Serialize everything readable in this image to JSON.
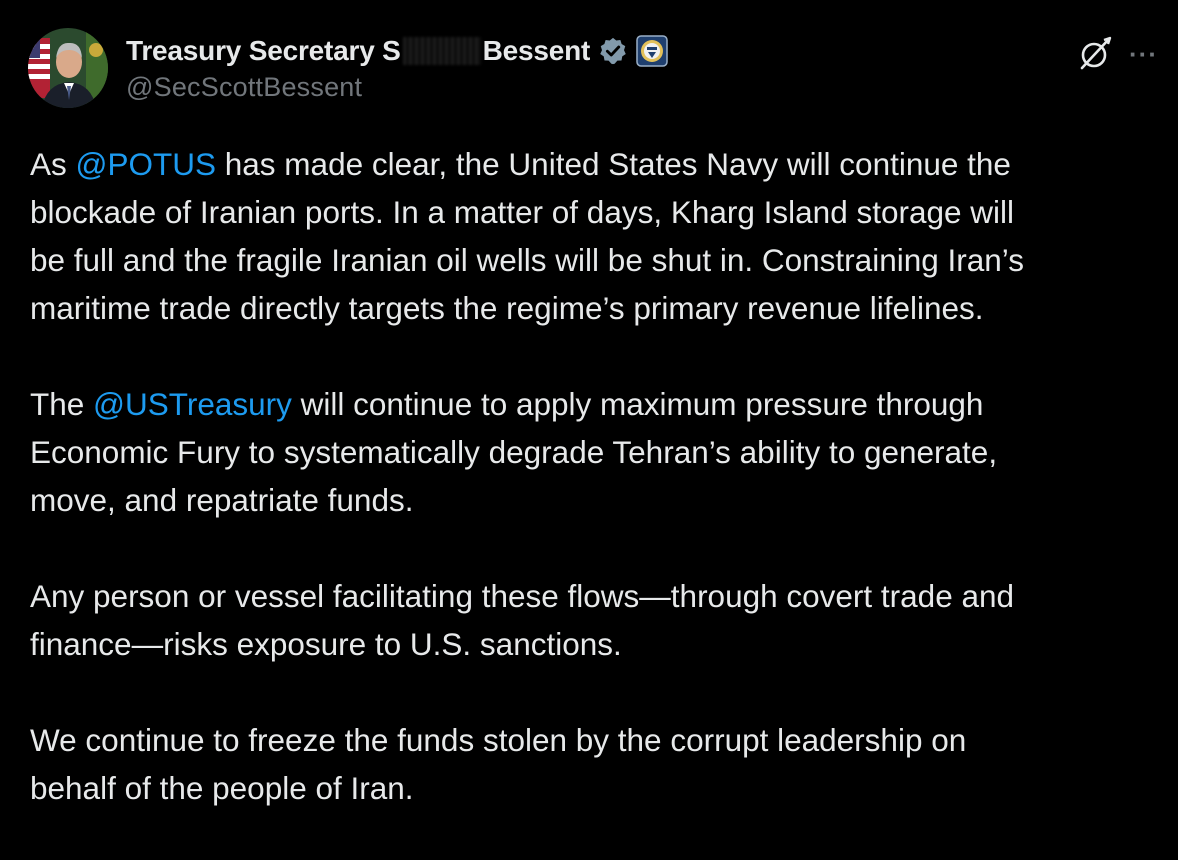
{
  "author": {
    "display_name_before": "Treasury Secretary S",
    "display_name_after": "Bessent",
    "handle": "@SecScottBessent",
    "avatar_icon": "avatar-photo",
    "verified_icon": "verified-badge-icon",
    "affiliation_icon": "treasury-seal-icon"
  },
  "actions": {
    "grok_icon": "grok-icon",
    "more_label": "···"
  },
  "colors": {
    "background": "#000000",
    "text": "#e7e9ea",
    "secondary": "#71767b",
    "mention": "#1d9bf0"
  },
  "post": {
    "p1": {
      "l1_pre": "As ",
      "l1_mention": "@POTUS",
      "l1_post": " has made clear, the United States Navy will continue the",
      "l2": "blockade of Iranian ports.  In a matter of days, Kharg Island storage will",
      "l3": "be full and the fragile Iranian oil wells will be shut in. Constraining Iran’s",
      "l4": "maritime trade directly targets the regime’s primary revenue lifelines."
    },
    "p2": {
      "l1_pre": "The ",
      "l1_mention": "@USTreasury",
      "l1_post": " will continue to apply maximum pressure through",
      "l2": "Economic Fury to systematically degrade Tehran’s ability to generate,",
      "l3": "move, and repatriate funds."
    },
    "p3": {
      "l1": "Any person or vessel facilitating these flows—through covert trade and",
      "l2": "finance—risks exposure to U.S. sanctions."
    },
    "p4": {
      "l1": "We continue to freeze the funds stolen by the corrupt leadership on",
      "l2": "behalf of the people of Iran."
    }
  }
}
